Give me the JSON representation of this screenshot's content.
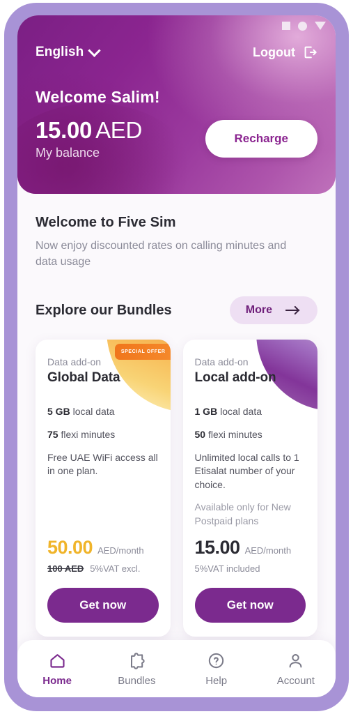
{
  "statusbar": {
    "icons": [
      "square-icon",
      "circle-icon",
      "triangle-down-icon"
    ]
  },
  "header": {
    "language_label": "English",
    "language_icon": "chevron-down-icon",
    "logout_label": "Logout",
    "logout_icon": "logout-icon",
    "welcome_text": "Welcome Salim!",
    "balance_amount": "15.00",
    "balance_currency": "AED",
    "balance_label": "My balance",
    "recharge_label": "Recharge",
    "gradient_start": "#7b1f84",
    "gradient_end": "#bf72bb"
  },
  "intro": {
    "title": "Welcome to Five Sim",
    "subtitle": "Now enjoy discounted rates on calling minutes and data usage"
  },
  "bundles_section": {
    "title": "Explore our Bundles",
    "more_label": "More",
    "more_icon": "arrow-right-icon",
    "more_bg": "#eedff3",
    "more_color": "#6f1f7a"
  },
  "cards": [
    {
      "badge": "SPECIAL OFFER",
      "badge_color": "#f0751b",
      "kicker": "Data add-on",
      "title": "Global Data",
      "decoration": "orange-blob",
      "features": [
        {
          "bold": "5 GB",
          "rest": "local data",
          "muted": false
        },
        {
          "bold": "75",
          "rest": "flexi minutes",
          "muted": false
        },
        {
          "bold": "",
          "rest": "Free UAE WiFi access all in one plan.",
          "muted": false
        }
      ],
      "price": "50.00",
      "price_color": "#f0b42a",
      "price_unit": "AED/month",
      "old_price": "100 AED",
      "vat_note": "5%VAT excl.",
      "cta_label": "Get now",
      "cta_color": "#7b2a8e"
    },
    {
      "badge": "",
      "badge_color": "",
      "kicker": "Data add-on",
      "title": "Local add-on",
      "decoration": "purple-blob",
      "features": [
        {
          "bold": "1 GB",
          "rest": "local data",
          "muted": false
        },
        {
          "bold": "50",
          "rest": "flexi minutes",
          "muted": false
        },
        {
          "bold": "",
          "rest": "Unlimited local calls to 1 Etisalat number of your choice.",
          "muted": false
        },
        {
          "bold": "",
          "rest": "Available only for New Postpaid plans",
          "muted": true
        }
      ],
      "price": "15.00",
      "price_color": "#2b2b33",
      "price_unit": "AED/month",
      "old_price": "",
      "vat_note": "5%VAT included",
      "cta_label": "Get now",
      "cta_color": "#7b2a8e"
    }
  ],
  "bottom_nav": {
    "items": [
      {
        "label": "Home",
        "icon": "home-icon",
        "active": true
      },
      {
        "label": "Bundles",
        "icon": "puzzle-piece-icon",
        "active": false
      },
      {
        "label": "Help",
        "icon": "question-circle-icon",
        "active": false
      },
      {
        "label": "Account",
        "icon": "person-icon",
        "active": false
      }
    ],
    "active_color": "#7b2a8e",
    "inactive_color": "#7a7a88"
  }
}
